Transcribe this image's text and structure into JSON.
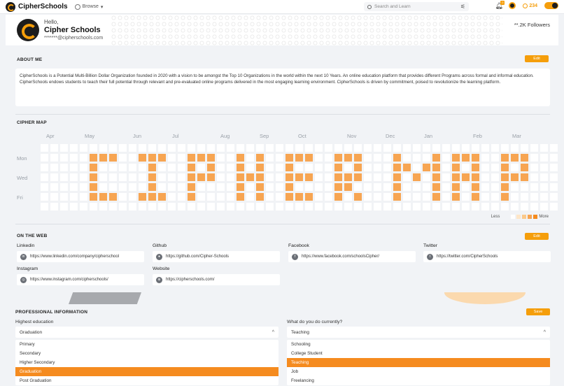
{
  "nav": {
    "brand": "CipherSchools",
    "browse": "Browse",
    "search_placeholder": "Search and Learn",
    "notif_count": "0",
    "coins": "234"
  },
  "profile": {
    "greeting": "Hello,",
    "name": "Cipher Schools",
    "email": "*******@cipherschools.com",
    "followers": "**.2K Followers"
  },
  "about": {
    "title": "ABOUT ME",
    "edit_label": "Edit",
    "text": "CipherSchools is a Potential Multi-Billion Dollar Organization founded in 2020 with a vision to be amongst the Top 10 Organizations in the world within the next 10 Years. An online education platform that provides different Programs across formal and informal education. CipherSchools endows students to teach their full potential through relevant and pre-evaluated online programs delivered in the most engaging learning environment. CipherSchools is driven by commitment, poised to revolutionize the learning platform."
  },
  "cipher_map": {
    "title": "CIPHER MAP",
    "months": [
      "Apr",
      "May",
      "Jun",
      "Jul",
      "Aug",
      "Sep",
      "Oct",
      "Nov",
      "Dec",
      "Jan",
      "Feb",
      "Mar"
    ],
    "days": [
      "Mon",
      "Wed",
      "Fri"
    ],
    "legend_less": "Less",
    "legend_more": "More",
    "active_color": "#f7a552",
    "active_cells": "grid spells CIPHER MAP"
  },
  "web": {
    "title": "ON THE WEB",
    "edit_label": "Edit",
    "fields": [
      {
        "label": "Linkedin",
        "value": "https://www.linkedin.com/company/cipherschool",
        "icon": "linkedin-icon"
      },
      {
        "label": "Github",
        "value": "https://github.com/Cipher-Schools",
        "icon": "github-icon"
      },
      {
        "label": "Facebook",
        "value": "https://www.facebook.com/schoolsCipher/",
        "icon": "facebook-icon"
      },
      {
        "label": "Twitter",
        "value": "https://twitter.com/CipherSchools",
        "icon": "twitter-icon"
      },
      {
        "label": "Instagram",
        "value": "https://www.instagram.com/cipherschools/",
        "icon": "instagram-icon"
      },
      {
        "label": "Website",
        "value": "https://cipherschools.com/",
        "icon": "globe-icon"
      }
    ]
  },
  "professional": {
    "title": "PROFESSIONAL INFORMATION",
    "save_label": "Save",
    "education_label": "Highest education",
    "education_value": "Graduation",
    "education_options": [
      "Primary",
      "Secondary",
      "Higher Secondary",
      "Graduation",
      "Post Graduation"
    ],
    "education_selected": 3,
    "current_label": "What do you do currently?",
    "current_value": "Teaching",
    "current_options": [
      "Schooling",
      "College Student",
      "Teaching",
      "Job",
      "Freelancing"
    ],
    "current_selected": 2
  },
  "colors": {
    "accent": "#f59e0b",
    "selected_option": "#f58b1f"
  }
}
